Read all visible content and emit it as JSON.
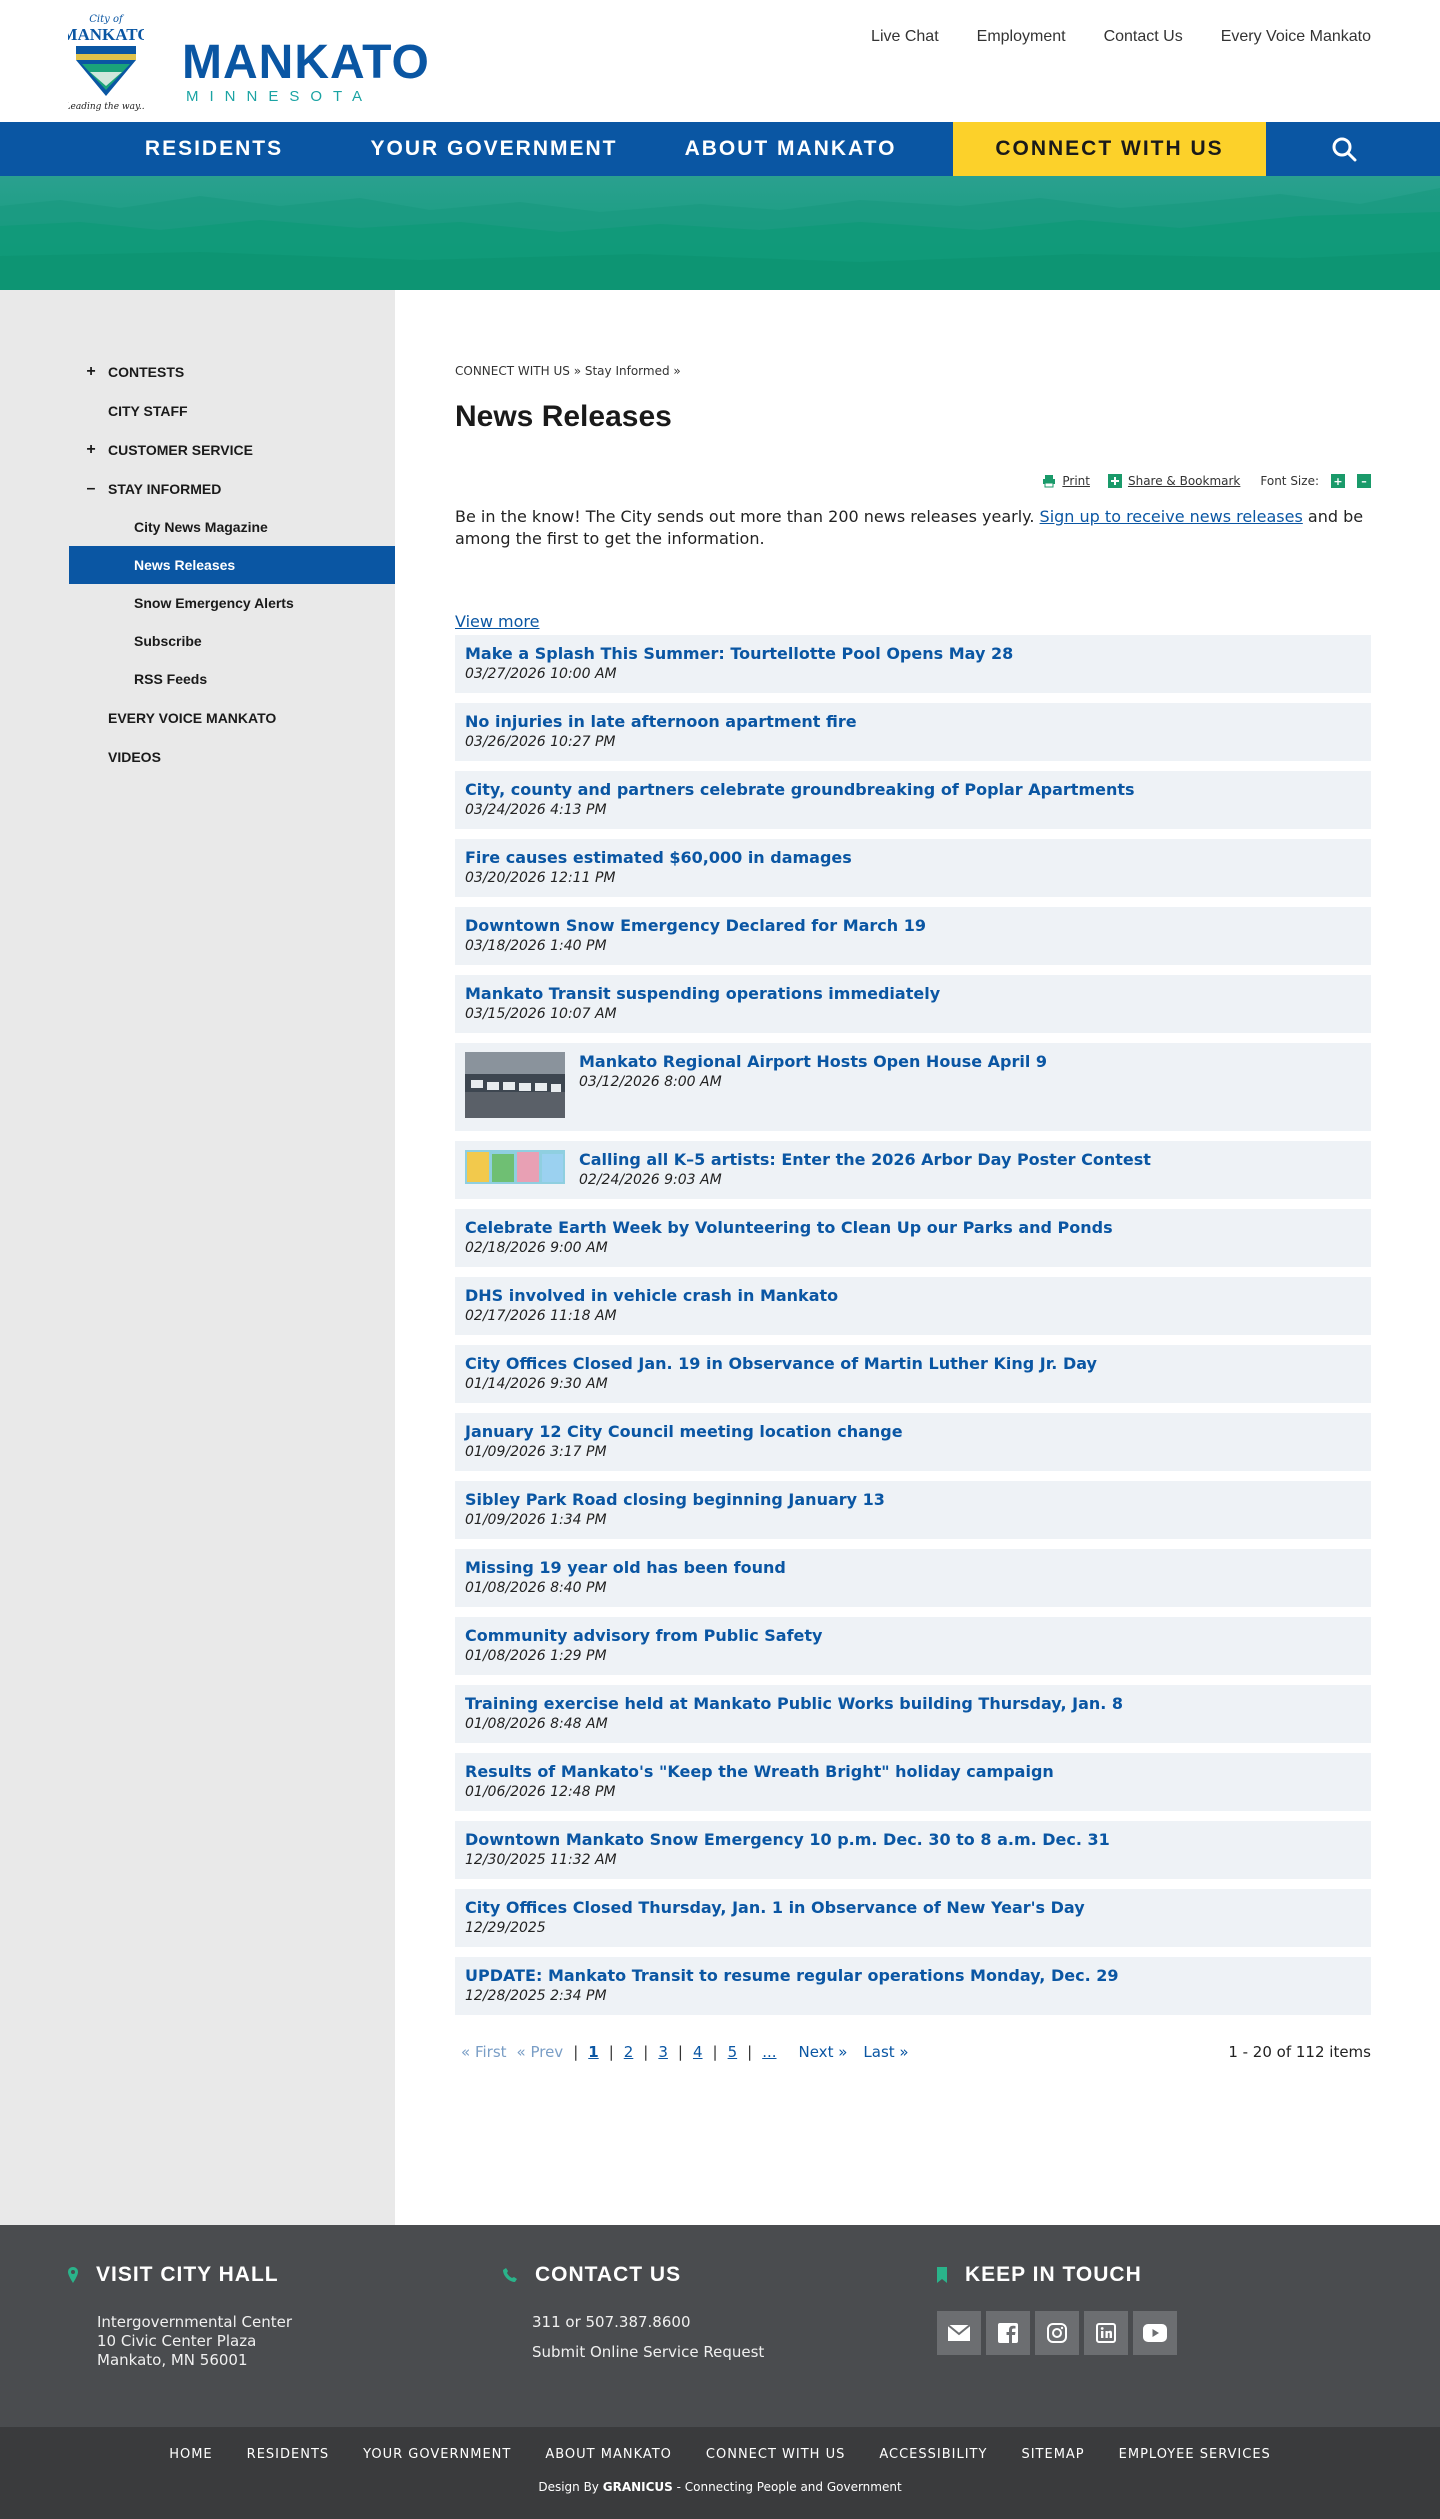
{
  "header": {
    "emblem_top": "City of",
    "emblem_name": "MANKATO",
    "emblem_tagline": "Leading the way...",
    "wordmark": "MANKATO",
    "wordmark_sub": "MINNESOTA",
    "utility_links": [
      "Live Chat",
      "Employment",
      "Contact Us",
      "Every Voice Mankato"
    ]
  },
  "main_nav": {
    "items": [
      "RESIDENTS",
      "YOUR GOVERNMENT",
      "ABOUT MANKATO",
      "CONNECT WITH US"
    ],
    "search_icon": "search-icon",
    "colors": {
      "nav_bg": "#0a56a3",
      "active_bg": "#fcd12a"
    }
  },
  "sidebar": {
    "items": [
      {
        "label": "CONTESTS",
        "toggle": "+"
      },
      {
        "label": "CITY STAFF",
        "toggle": ""
      },
      {
        "label": "CUSTOMER SERVICE",
        "toggle": "+"
      },
      {
        "label": "STAY INFORMED",
        "toggle": "–"
      }
    ],
    "sub_items": [
      "City News Magazine",
      "News Releases",
      "Snow Emergency Alerts",
      "Subscribe",
      "RSS Feeds"
    ],
    "after_items": [
      "EVERY VOICE MANKATO",
      "VIDEOS"
    ]
  },
  "breadcrumb": {
    "level1": "CONNECT WITH US",
    "sep": "»",
    "level2": "Stay Informed"
  },
  "page_title": "News Releases",
  "tools": {
    "print": "Print",
    "share": "Share & Bookmark",
    "font_size": "Font Size:",
    "increase": "+",
    "decrease": "–"
  },
  "intro": {
    "before": "Be in the know! The City sends out more than 200 news releases yearly. ",
    "link": "Sign up to receive news releases",
    "after": " and be among the first to get the information."
  },
  "view_more": "View more",
  "news": [
    {
      "title": "Make a Splash This Summer: Tourtellotte Pool Opens May 28",
      "date": "03/27/2026 10:00 AM"
    },
    {
      "title": "No injuries in late afternoon apartment fire",
      "date": "03/26/2026 10:27 PM"
    },
    {
      "title": "City, county and partners celebrate groundbreaking of Poplar Apartments",
      "date": "03/24/2026 4:13 PM"
    },
    {
      "title": "Fire causes estimated $60,000 in damages",
      "date": "03/20/2026 12:11 PM"
    },
    {
      "title": "Downtown Snow Emergency Declared for March 19",
      "date": "03/18/2026 1:40 PM"
    },
    {
      "title": "Mankato Transit suspending operations immediately",
      "date": "03/15/2026 10:07 AM"
    },
    {
      "title": "Mankato Regional Airport Hosts Open House April 9",
      "date": "03/12/2026 8:00 AM"
    },
    {
      "title": "Calling all K–5 artists: Enter the 2026 Arbor Day Poster Contest",
      "date": "02/24/2026 9:03 AM"
    },
    {
      "title": "Celebrate Earth Week by Volunteering to Clean Up our Parks and Ponds",
      "date": "02/18/2026 9:00 AM"
    },
    {
      "title": "DHS involved in vehicle crash in Mankato",
      "date": "02/17/2026 11:18 AM"
    },
    {
      "title": "City Offices Closed Jan. 19 in Observance of Martin Luther King Jr. Day",
      "date": "01/14/2026 9:30 AM"
    },
    {
      "title": "January 12 City Council meeting location change",
      "date": "01/09/2026 3:17 PM"
    },
    {
      "title": "Sibley Park Road closing beginning January 13",
      "date": "01/09/2026 1:34 PM"
    },
    {
      "title": "Missing 19 year old has been found",
      "date": "01/08/2026 8:40 PM"
    },
    {
      "title": "Community advisory from Public Safety",
      "date": "01/08/2026 1:29 PM"
    },
    {
      "title": "Training exercise held at Mankato Public Works building Thursday, Jan. 8",
      "date": "01/08/2026 8:48 AM"
    },
    {
      "title": "Results of Mankato's \"Keep the Wreath Bright\" holiday campaign",
      "date": "01/06/2026 12:48 PM"
    },
    {
      "title": "Downtown Mankato Snow Emergency 10 p.m. Dec. 30 to 8 a.m. Dec. 31",
      "date": "12/30/2025 11:32 AM"
    },
    {
      "title": "City Offices Closed Thursday, Jan. 1 in Observance of New Year's Day",
      "date": "12/29/2025"
    },
    {
      "title": "UPDATE: Mankato Transit to resume regular operations Monday, Dec. 29",
      "date": "12/28/2025 2:34 PM"
    }
  ],
  "pager": {
    "first": "« First",
    "prev": "« Prev",
    "pages": [
      "1",
      "2",
      "3",
      "4",
      "5",
      "..."
    ],
    "next": "Next »",
    "last": "Last »",
    "count": "1 - 20 of 112 items"
  },
  "footer": {
    "visit": {
      "heading": "VISIT CITY HALL",
      "line1": "Intergovernmental Center",
      "line2": "10 Civic Center Plaza",
      "line3": "Mankato, MN 56001"
    },
    "contact": {
      "heading": "CONTACT US",
      "phone": "311 or 507.387.8600",
      "link": "Submit Online Service Request"
    },
    "keep": {
      "heading": "KEEP IN TOUCH",
      "icons": [
        "email-icon",
        "facebook-icon",
        "instagram-icon",
        "linkedin-icon",
        "youtube-icon"
      ]
    },
    "links": [
      "HOME",
      "RESIDENTS",
      "YOUR GOVERNMENT",
      "ABOUT MANKATO",
      "CONNECT WITH US",
      "ACCESSIBILITY",
      "SITEMAP",
      "EMPLOYEE SERVICES"
    ],
    "credit_prefix": "Design By ",
    "credit_brand": "GRANICUS",
    "credit_suffix": " - Connecting People and Government"
  }
}
